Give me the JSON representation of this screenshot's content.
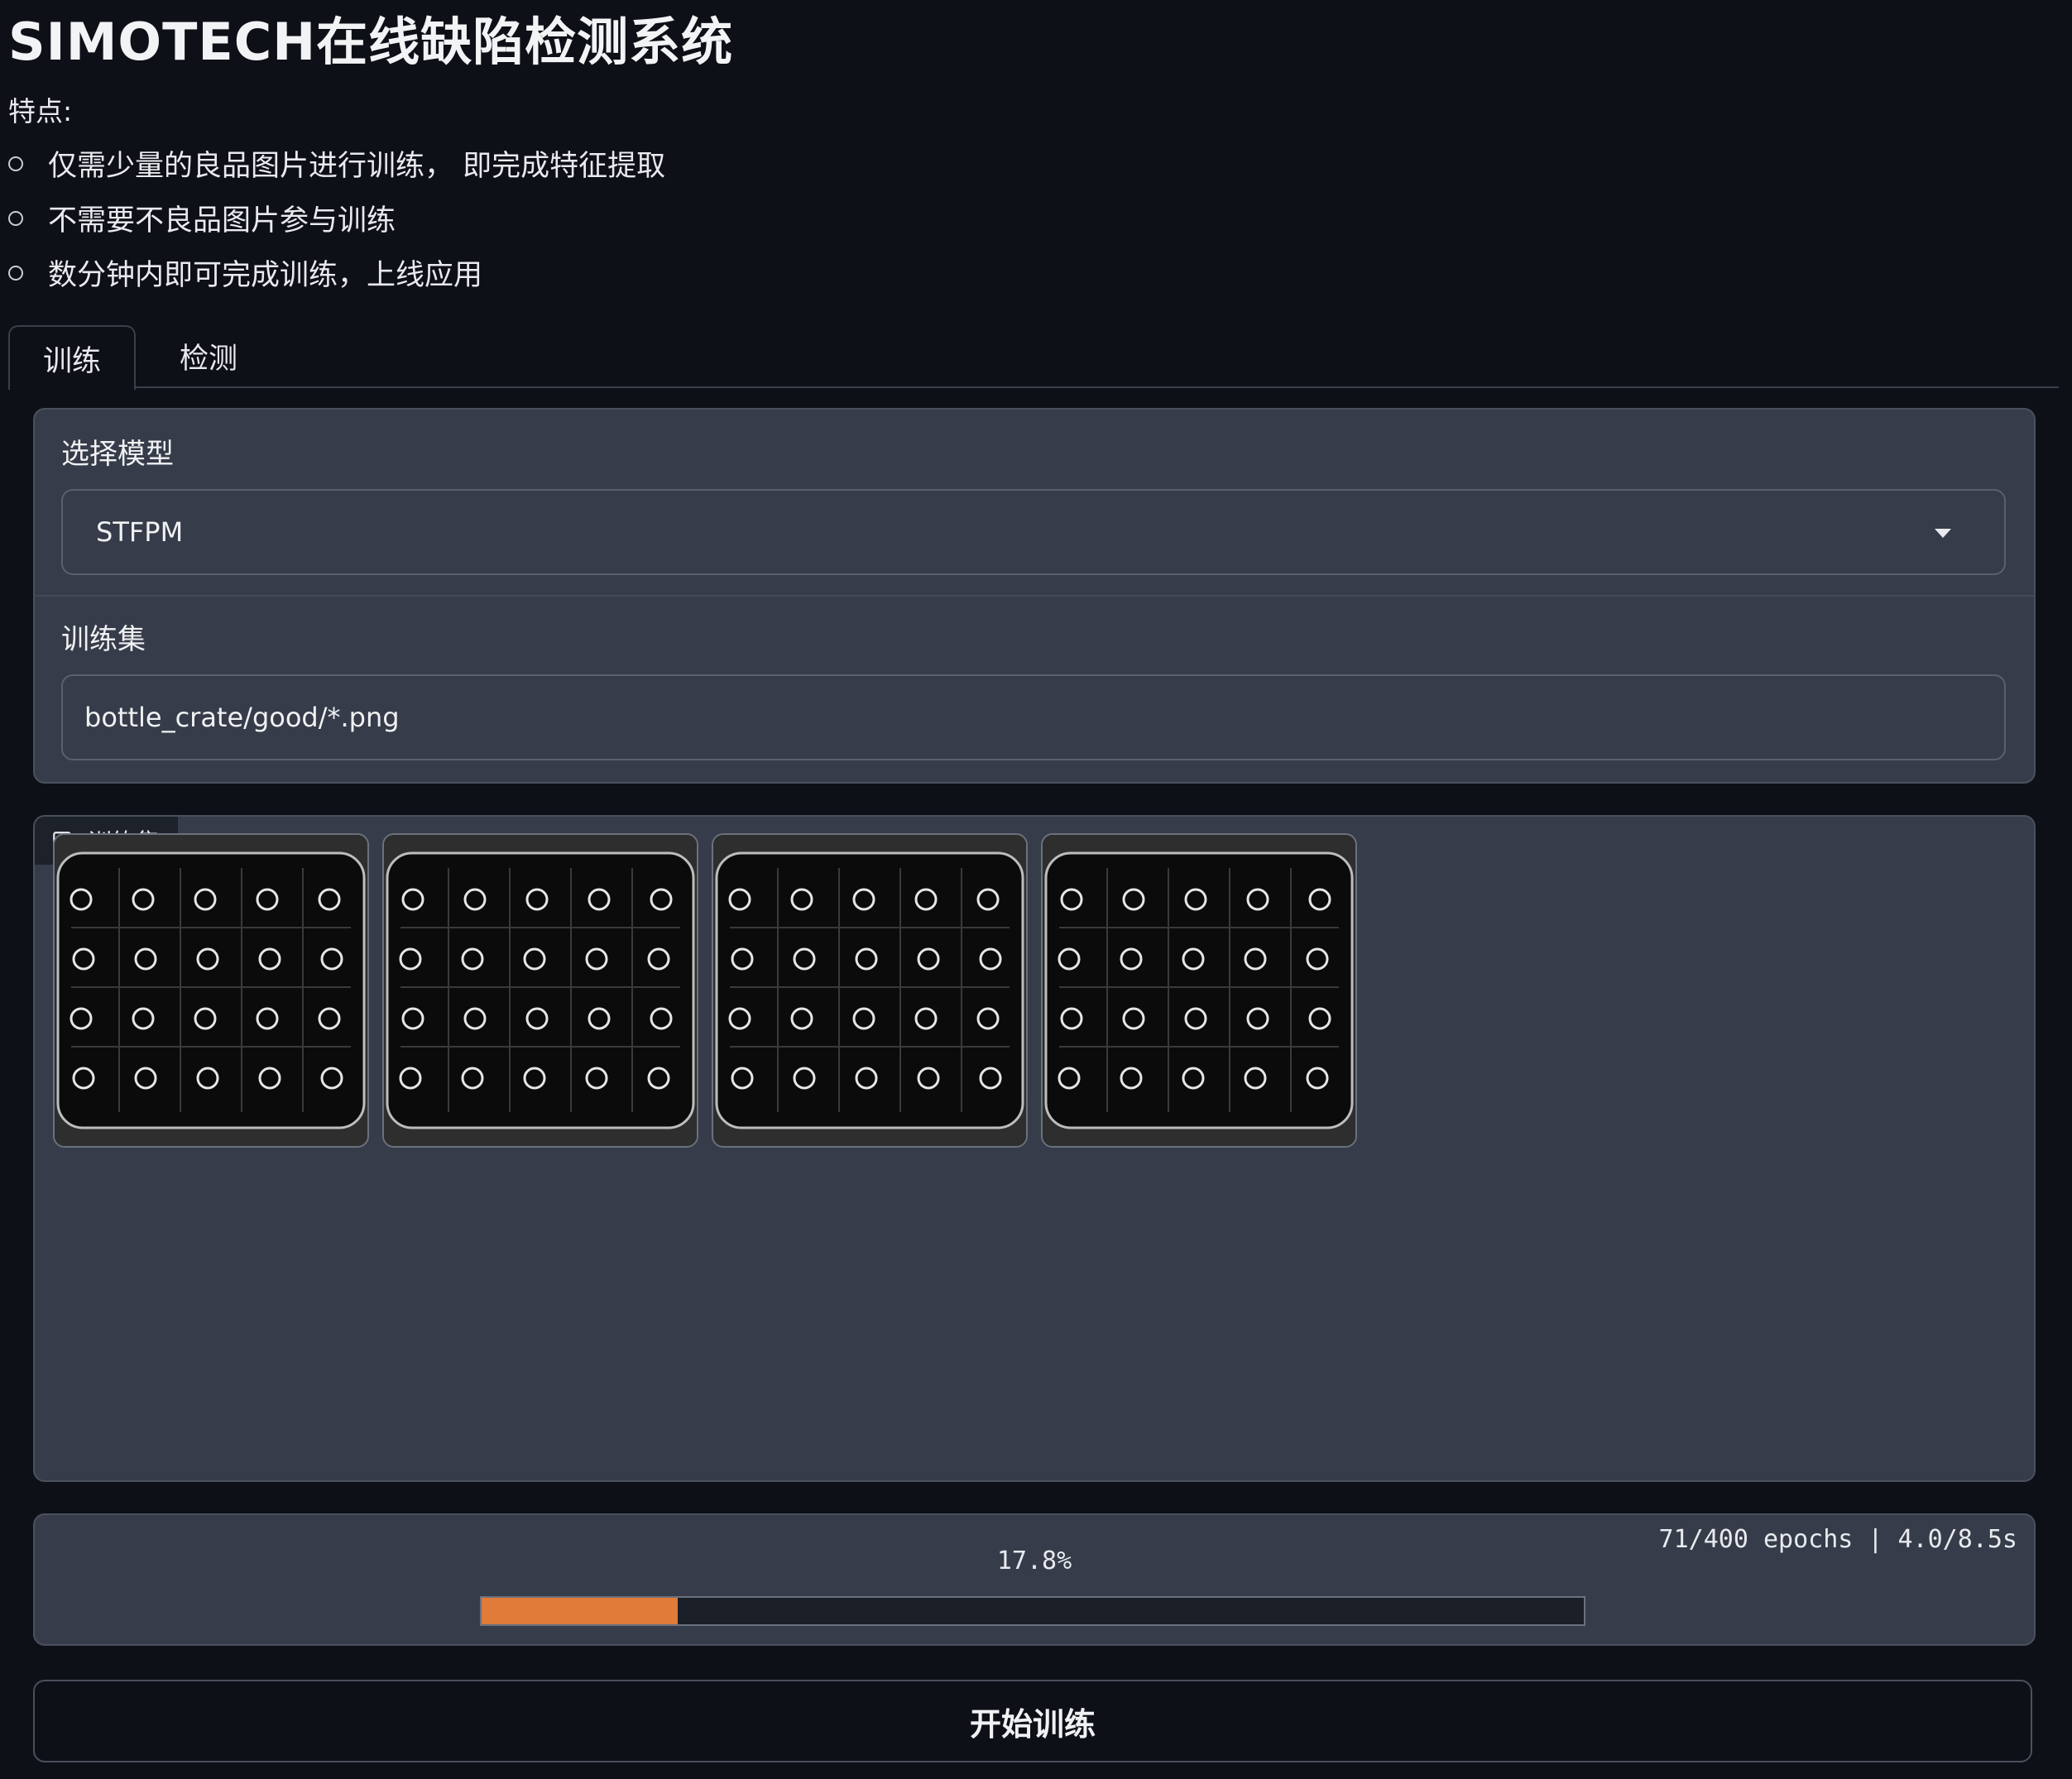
{
  "header": {
    "title": "SIMOTECH在线缺陷检测系统",
    "features_label": "特点:",
    "features": [
      "仅需少量的良品图片进行训练， 即完成特征提取",
      "不需要不良品图片参与训练",
      "数分钟内即可完成训练，上线应用"
    ]
  },
  "tabs": [
    {
      "label": "训练",
      "active": true
    },
    {
      "label": "检测",
      "active": false
    }
  ],
  "model": {
    "label": "选择模型",
    "selected": "STFPM"
  },
  "trainset": {
    "label": "训练集",
    "value": "bottle_crate/good/*.png"
  },
  "gallery": {
    "label": "训练集",
    "icon": "image-icon",
    "thumbnails": [
      "bottle-crate-image-1",
      "bottle-crate-image-2",
      "bottle-crate-image-3",
      "bottle-crate-image-4"
    ]
  },
  "progress": {
    "percent_text": "17.8%",
    "value": 0.178,
    "eta_text": "71/400 epochs | 4.0/8.5s"
  },
  "actions": {
    "start_label": "开始训练"
  },
  "colors": {
    "background": "#0d1017",
    "panel": "#363c49",
    "progress": "#e07b39"
  }
}
